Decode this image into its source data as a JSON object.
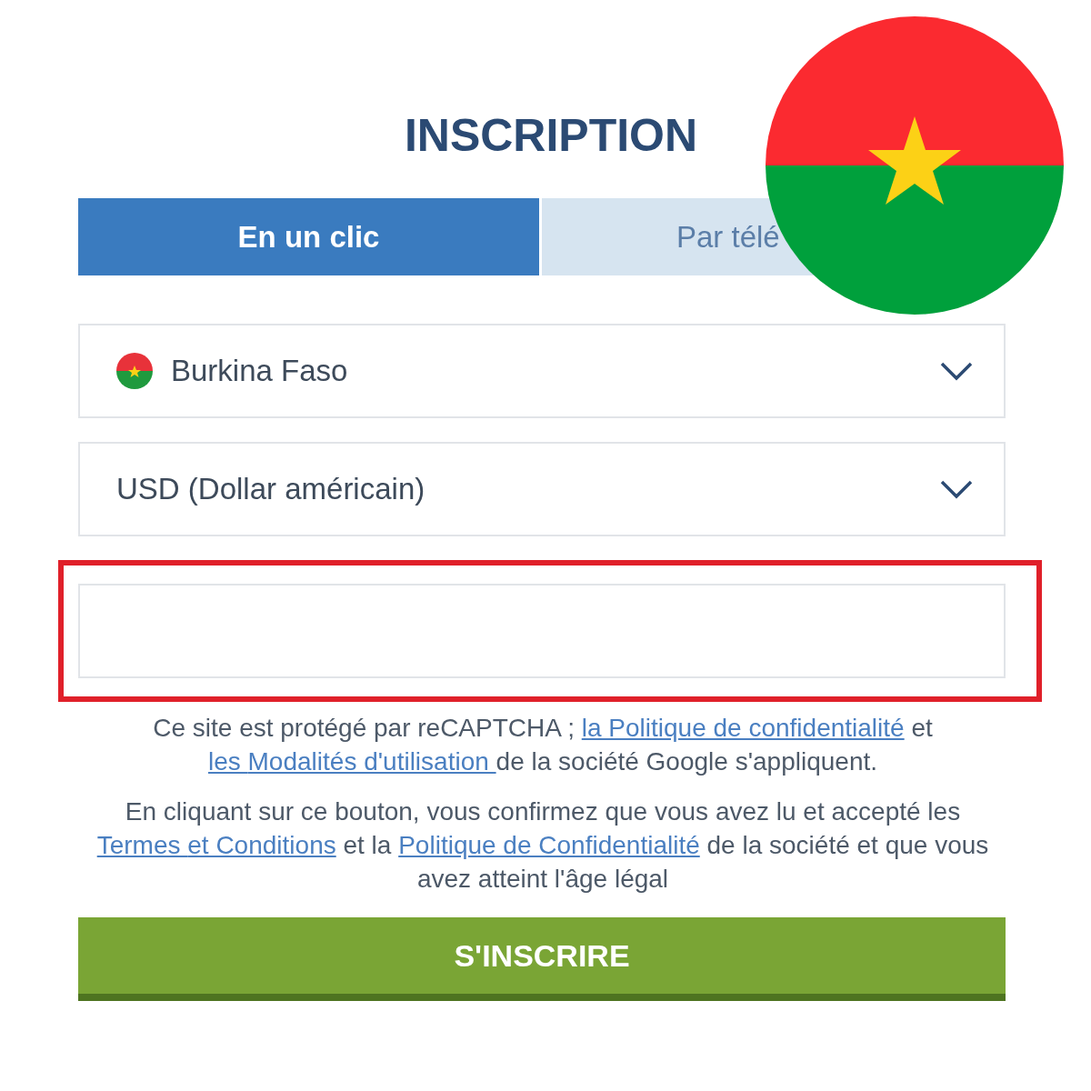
{
  "title": "INSCRIPTION",
  "tabs": [
    {
      "label": "En un clic",
      "selected": true
    },
    {
      "label": "Par télé",
      "selected": false
    }
  ],
  "fields": [
    {
      "kind": "country-select",
      "value": "Burkina Faso"
    },
    {
      "kind": "select",
      "value": "USD (Dollar américain)"
    },
    {
      "kind": "highlighted-input"
    }
  ],
  "notices": [
    [
      {
        "kind": "text",
        "text": "Ce site est protégé par reCAPTCHA ; "
      },
      {
        "kind": "link",
        "text": "la Politique de confidentialité"
      },
      {
        "kind": "text",
        "text": " et "
      },
      {
        "kind": "link",
        "text": "les "
      },
      {
        "kind": "link",
        "text": "Modalités d'utilisation "
      },
      {
        "kind": "text",
        "text": "de la société Google s'appliquent."
      }
    ],
    [
      {
        "kind": "text",
        "text": "En cliquant sur ce bouton, vous confirmez que vous avez lu et accepté les "
      },
      {
        "kind": "link",
        "text": "Termes "
      },
      {
        "kind": "link",
        "text": "et Conditions"
      },
      {
        "kind": "text",
        "text": " et la "
      },
      {
        "kind": "link",
        "text": "Politique de Confidentialité"
      },
      {
        "kind": "text",
        "text": " de la société et que vous avez atteint l'âge légal"
      }
    ]
  ],
  "submit": "S'INSCRIRE",
  "overlay_flag": true
}
